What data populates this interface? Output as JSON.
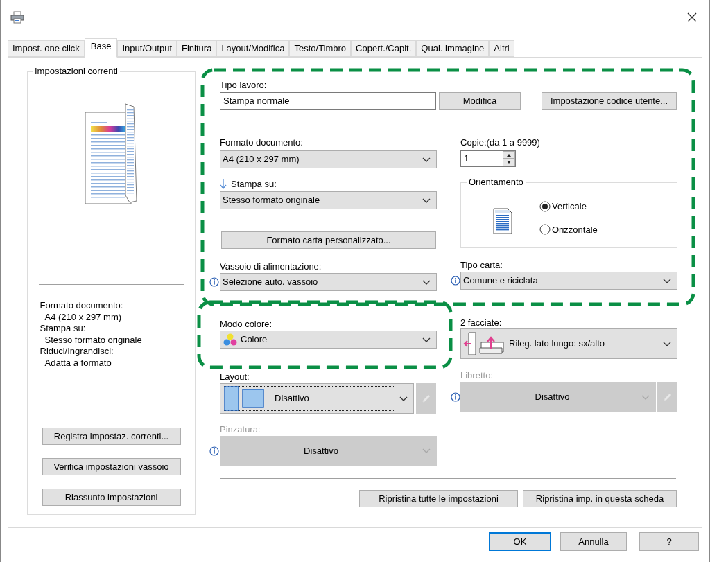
{
  "tabs": [
    {
      "label": "Impost. one click",
      "selected": false
    },
    {
      "label": "Base",
      "selected": true
    },
    {
      "label": "Input/Output",
      "selected": false
    },
    {
      "label": "Finitura",
      "selected": false
    },
    {
      "label": "Layout/Modifica",
      "selected": false
    },
    {
      "label": "Testo/Timbro",
      "selected": false
    },
    {
      "label": "Copert./Capit.",
      "selected": false
    },
    {
      "label": "Qual. immagine",
      "selected": false
    },
    {
      "label": "Altri",
      "selected": false
    }
  ],
  "current_settings": {
    "title": "Impostazioni correnti",
    "summary": [
      {
        "kind": "heading",
        "text": "Formato documento:"
      },
      {
        "kind": "value",
        "text": "A4 (210 x 297 mm)"
      },
      {
        "kind": "heading",
        "text": "Stampa su:"
      },
      {
        "kind": "value",
        "text": "Stesso formato originale"
      },
      {
        "kind": "heading",
        "text": "Riduci/Ingrandisci:"
      },
      {
        "kind": "value",
        "text": "Adatta a formato"
      }
    ],
    "buttons": [
      "Registra impostaz. correnti...",
      "Verifica impostazioni vassoio",
      "Riassunto impostazioni"
    ]
  },
  "job_type": {
    "label": "Tipo lavoro:",
    "value": "Stampa normale",
    "buttons": [
      "Modifica",
      "Impostazione codice utente..."
    ]
  },
  "paper_size": {
    "label": "Formato documento:",
    "value": "A4 (210 x 297 mm)"
  },
  "copies": {
    "label": "Copie:(da 1 a 9999)",
    "value": "1"
  },
  "print_on": {
    "label": "Stampa su:",
    "value": "Stesso formato originale"
  },
  "orientation": {
    "title": "Orientamento",
    "options": [
      {
        "label": "Verticale",
        "selected": true
      },
      {
        "label": "Orizzontale",
        "selected": false
      }
    ]
  },
  "custom_paper_button": "Formato carta personalizzato...",
  "input_tray": {
    "label": "Vassoio di alimentazione:",
    "value": "Selezione auto. vassoio",
    "info": true
  },
  "paper_type": {
    "label": "Tipo carta:",
    "value": "Comune e riciclata",
    "info": true
  },
  "color_mode": {
    "label": "Modo colore:",
    "value": "Colore"
  },
  "duplex": {
    "label": "2 facciate:",
    "value": "Rileg. lato lungo: sx/alto"
  },
  "layout": {
    "label": "Layout:",
    "value": "Disattivo",
    "disabled": false,
    "focused": true
  },
  "booklet": {
    "label": "Libretto:",
    "value": "Disattivo",
    "disabled": true,
    "info": true
  },
  "staple": {
    "label": "Pinzatura:",
    "value": "Disattivo",
    "disabled": true,
    "info": true
  },
  "reset_buttons": [
    "Ripristina tutte le impostazioni",
    "Ripristina imp. in questa scheda"
  ],
  "dialog_buttons": [
    {
      "label": "OK",
      "default": true
    },
    {
      "label": "Annulla",
      "default": false
    },
    {
      "label": "?",
      "default": false
    }
  ]
}
